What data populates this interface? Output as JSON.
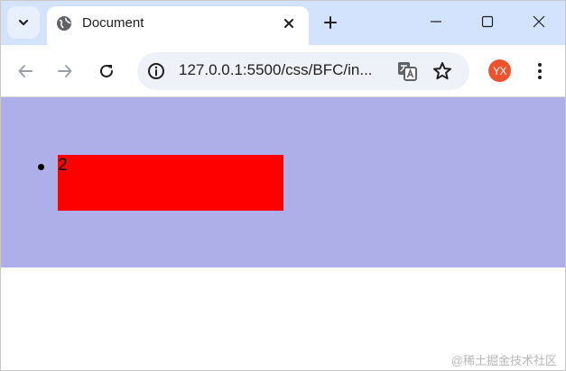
{
  "tab": {
    "title": "Document"
  },
  "omnibox": {
    "url": "127.0.0.1:5500/css/BFC/in..."
  },
  "profile": {
    "initials": "YX",
    "color": "#f0522d"
  },
  "page": {
    "background": "#aeaee8",
    "list_items": [
      {
        "text": "2",
        "background": "#ff0000"
      }
    ]
  },
  "watermark": {
    "text": "@稀土掘金技术社区"
  },
  "colors": {
    "tabstrip": "#d3e3fd",
    "omnibox": "#eef1f7"
  },
  "icons": [
    "tab-search-icon",
    "globe-icon",
    "close-icon",
    "plus-icon",
    "minimize-icon",
    "maximize-icon",
    "window-close-icon",
    "back-arrow-icon",
    "forward-arrow-icon",
    "reload-icon",
    "info-icon",
    "translate-icon",
    "star-icon",
    "kebab-menu-icon"
  ]
}
